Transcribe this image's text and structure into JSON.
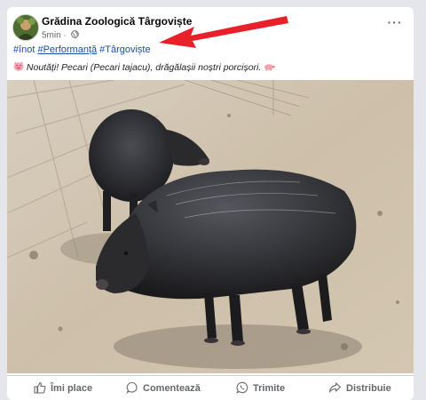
{
  "post": {
    "page_name": "Grădina Zoologică Târgoviște",
    "time": "5min",
    "privacy_icon": "globe-icon",
    "more_icon": "more-options-icon",
    "hashtags": [
      "#înot",
      "#Performanță",
      "#Târgoviște"
    ],
    "caption_emoji": "pig-face-icon",
    "caption_lead": "Noutăți!",
    "caption_italic": "Pecari",
    "caption_rest": " (Pecari tajacu), drăgălașii noștri porcișori.",
    "caption_end_emoji": "pig-icon",
    "photo_icon": "peccary-photo"
  },
  "actions": [
    {
      "label": "Îmi place",
      "icon": "like-icon"
    },
    {
      "label": "Comentează",
      "icon": "comment-icon"
    },
    {
      "label": "Trimite",
      "icon": "whatsapp-icon"
    },
    {
      "label": "Distribuie",
      "icon": "share-icon"
    }
  ],
  "colors": {
    "annotation_arrow": "#e8202a",
    "hashtag": "#1a4ea8"
  }
}
